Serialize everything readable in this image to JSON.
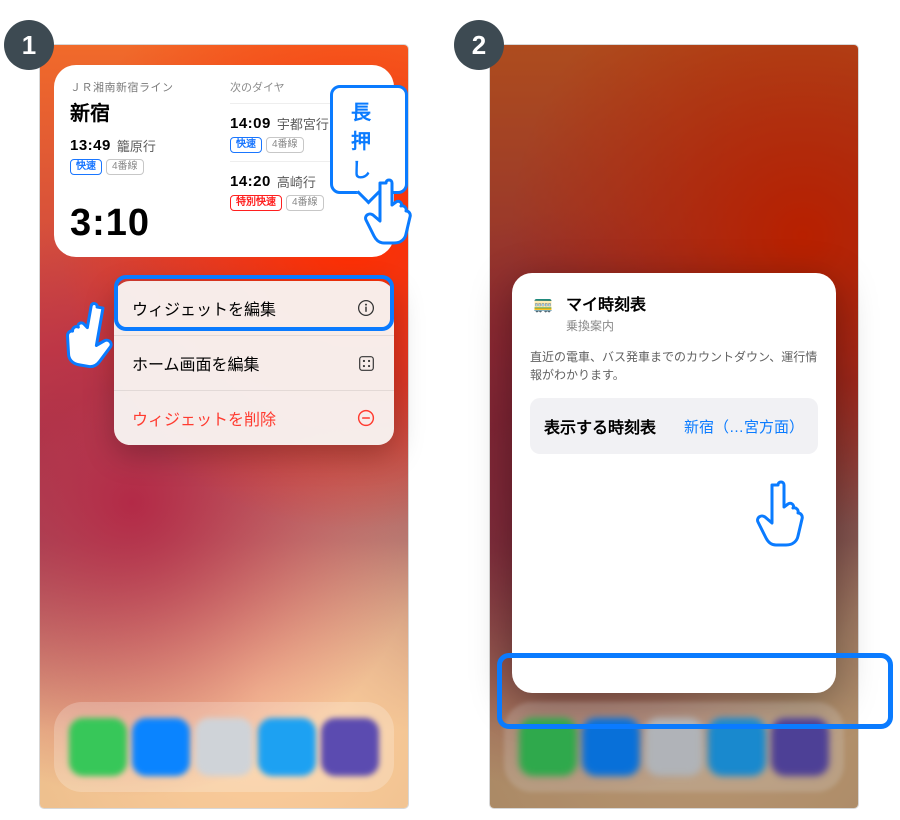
{
  "steps": {
    "one": "1",
    "two": "2"
  },
  "callouts": {
    "long_press": "長押し"
  },
  "widget": {
    "line_name": "ＪＲ湘南新宿ライン",
    "station": "新宿",
    "next_label": "次のダイヤ",
    "countdown": "3:10",
    "primary": {
      "time": "13:49",
      "dest": "籠原行",
      "rapid_tag": "快速",
      "platform_tag": "4番線"
    },
    "upcoming": [
      {
        "time": "14:09",
        "dest": "宇都宮行",
        "type_tag": "快速",
        "type_style": "rapid",
        "platform_tag": "4番線"
      },
      {
        "time": "14:20",
        "dest": "高崎行",
        "type_tag": "特別快速",
        "type_style": "special",
        "platform_tag": "4番線"
      }
    ]
  },
  "context_menu": {
    "edit_widget": "ウィジェットを編集",
    "edit_home": "ホーム画面を編集",
    "remove_widget": "ウィジェットを削除"
  },
  "settings": {
    "title": "マイ時刻表",
    "subtitle": "乗換案内",
    "description": "直近の電車、バス発車までのカウントダウン、運行情報がわかります。",
    "row_label": "表示する時刻表",
    "row_value": "新宿（…宮方面）"
  }
}
